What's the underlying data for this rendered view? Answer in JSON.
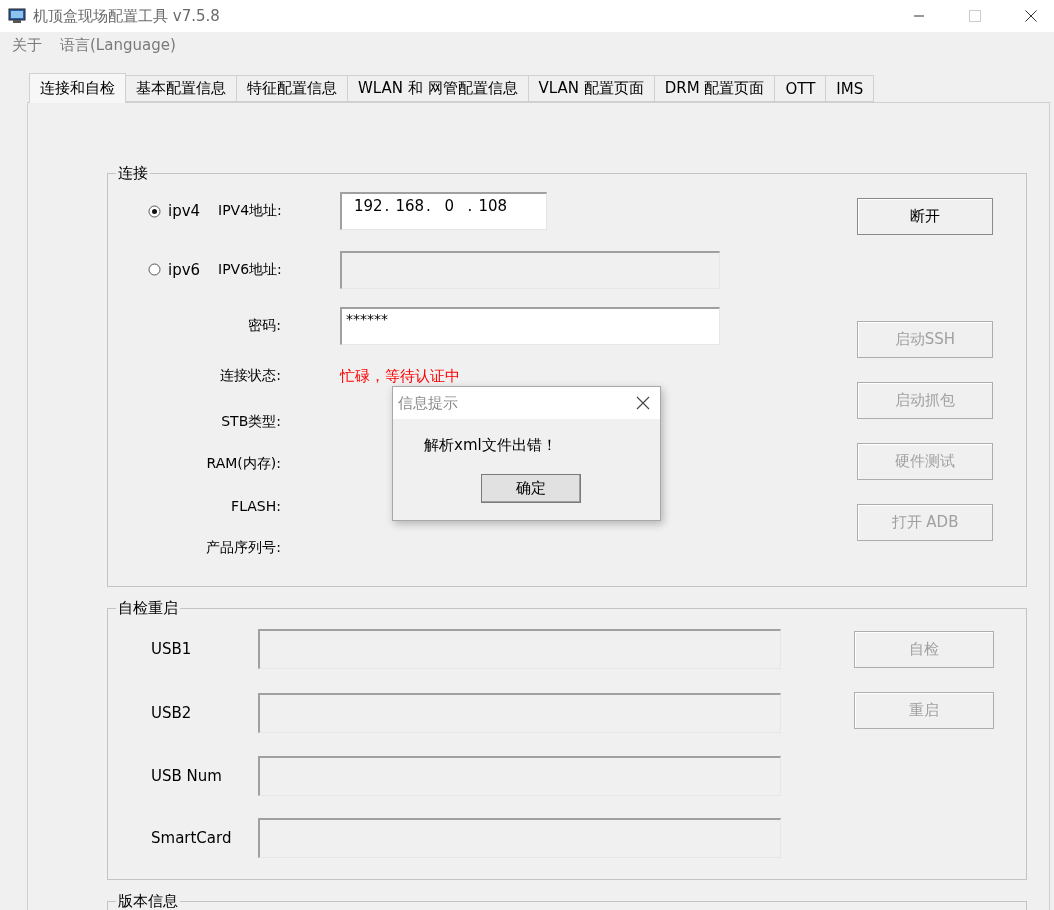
{
  "window": {
    "title": "机顶盒现场配置工具 v7.5.8"
  },
  "menu": [
    "关于",
    "语言(Language)"
  ],
  "tabs": [
    {
      "label": "连接和自检",
      "selected": true
    },
    {
      "label": "基本配置信息",
      "selected": false
    },
    {
      "label": "特征配置信息",
      "selected": false
    },
    {
      "label": "WLAN 和 网管配置信息",
      "selected": false
    },
    {
      "label": "VLAN 配置页面",
      "selected": false
    },
    {
      "label": "DRM 配置页面",
      "selected": false
    },
    {
      "label": "OTT",
      "selected": false
    },
    {
      "label": "IMS",
      "selected": false
    }
  ],
  "connection": {
    "title": "连接",
    "address_rows": [
      {
        "radio": "ipv4",
        "selected": true,
        "label": "IPV4地址:",
        "kind": "ip",
        "parts": [
          "192",
          ".",
          "168",
          ".",
          "0",
          ".",
          "108"
        ],
        "disabled": false
      },
      {
        "radio": "ipv6",
        "selected": false,
        "label": "IPV6地址:",
        "kind": "text",
        "disabled": true
      }
    ],
    "password": {
      "label": "密码:",
      "value": "******",
      "disabled": false
    },
    "status": {
      "label": "连接状态:",
      "value": "忙碌，等待认证中"
    },
    "info_labels": [
      "STB类型:",
      "RAM(内存):",
      "FLASH:",
      "产品序列号:"
    ],
    "buttons": [
      {
        "label": "断开",
        "disabled": false
      },
      {
        "label": "启动SSH",
        "disabled": true
      },
      {
        "label": "启动抓包",
        "disabled": true
      },
      {
        "label": "硬件测试",
        "disabled": true
      },
      {
        "label": "打开 ADB",
        "disabled": true
      }
    ]
  },
  "self_check": {
    "title": "自检重启",
    "fields": [
      {
        "label": "USB1",
        "disabled": true
      },
      {
        "label": "USB2",
        "disabled": true
      },
      {
        "label": "USB Num",
        "disabled": true
      },
      {
        "label": "SmartCard",
        "disabled": true
      }
    ],
    "buttons": [
      {
        "label": "自检",
        "disabled": true
      },
      {
        "label": "重启",
        "disabled": true
      }
    ]
  },
  "version_info": {
    "title": "版本信息"
  },
  "dialog": {
    "title": "信息提示",
    "message": "解析xml文件出错！",
    "button": "确定"
  }
}
